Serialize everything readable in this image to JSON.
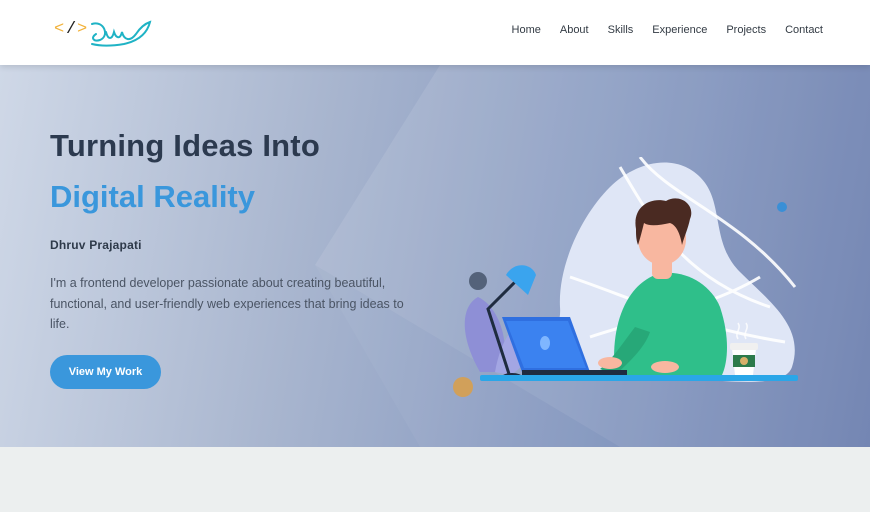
{
  "nav": {
    "logo_alt": "Dhruv logo",
    "links": [
      "Home",
      "About",
      "Skills",
      "Experience",
      "Projects",
      "Contact"
    ]
  },
  "hero": {
    "headline": "Turning Ideas Into",
    "headline_accent": "Digital Reality",
    "author": "Dhruv Prajapati",
    "intro": "I'm a frontend developer passionate about creating beautiful, functional, and user-friendly web experiences that bring ideas to life.",
    "cta_label": "View My Work"
  },
  "colors": {
    "accent": "#3a97dc",
    "heading": "#2c3a4f",
    "shirt": "#2fbf8a",
    "hair": "#4a2a22"
  }
}
